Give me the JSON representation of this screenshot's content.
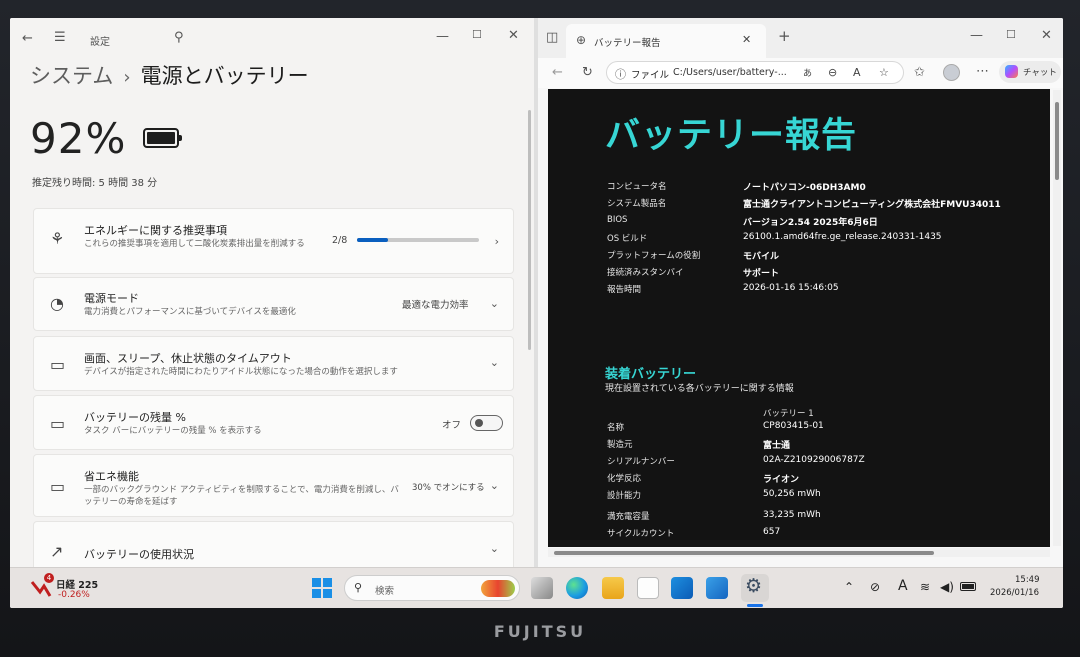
{
  "settings": {
    "app_label": "設定",
    "breadcrumb": {
      "parent": "システム",
      "separator": "›",
      "current": "電源とバッテリー"
    },
    "battery_percent": "92%",
    "remaining": "推定残り時間: 5 時間 38 分",
    "cards": {
      "energy": {
        "title": "エネルギーに関する推奨事項",
        "desc": "これらの推奨事項を適用して二酸化炭素排出量を削減する",
        "value": "2/8",
        "progress": 0.25
      },
      "power_mode": {
        "title": "電源モード",
        "desc": "電力消費とパフォーマンスに基づいてデバイスを最適化",
        "value": "最適な電力効率"
      },
      "screen_sleep": {
        "title": "画面、スリープ、休止状態のタイムアウト",
        "desc": "デバイスが指定された時間にわたりアイドル状態になった場合の動作を選択します"
      },
      "battery_pct": {
        "title": "バッテリーの残量 %",
        "desc": "タスク バーにバッテリーの残量 % を表示する",
        "value": "オフ",
        "toggle_on": false
      },
      "saver": {
        "title": "省エネ機能",
        "desc": "一部のバックグラウンド アクティビティを制限することで、電力消費を削減し、バッテリーの寿命を延ばす",
        "value": "30% でオンにする"
      },
      "usage": {
        "title": "バッテリーの使用状況"
      }
    }
  },
  "edge": {
    "tab_title": "バッテリー報告",
    "url_prefix": "ファイル",
    "url": "C:/Users/user/battery-...",
    "copilot_label": "チャット",
    "report": {
      "title": "バッテリー報告",
      "system": [
        {
          "k": "コンピュータ名",
          "v": "ノートパソコン-06DH3AM0"
        },
        {
          "k": "システム製品名",
          "v": "富士通クライアントコンピューティング株式会社FMVU34011"
        },
        {
          "k": "BIOS",
          "v": "バージョン2.54 2025年6月6日"
        },
        {
          "k": "OS ビルド",
          "v": "26100.1.amd64fre.ge_release.240331-1435"
        },
        {
          "k": "プラットフォームの役割",
          "v": "モバイル"
        },
        {
          "k": "接続済みスタンバイ",
          "v": "サポート"
        },
        {
          "k": "報告時間",
          "v": "2026-01-16  15:46:05"
        }
      ],
      "installed_title": "装着バッテリー",
      "installed_sub": "現在設置されている各バッテリーに関する情報",
      "column_head": "バッテリー 1",
      "battery": [
        {
          "k": "名称",
          "v": "CP803415-01"
        },
        {
          "k": "製造元",
          "v": "富士通"
        },
        {
          "k": "シリアルナンバー",
          "v": "02A-Z210929006787Z"
        },
        {
          "k": "化学反応",
          "v": "ライオン"
        },
        {
          "k": "設計能力",
          "v": "50,256 mWh"
        },
        {
          "k": "満充電容量",
          "v": "33,235 mWh"
        },
        {
          "k": "サイクルカウント",
          "v": "657"
        }
      ]
    }
  },
  "taskbar": {
    "stock_badge": "4",
    "stock_name": "日経 225",
    "stock_change": "-0.26%",
    "search_placeholder": "検索",
    "time": "15:49",
    "date": "2026/01/16",
    "ime": "A"
  },
  "brand": "FUJITSU"
}
